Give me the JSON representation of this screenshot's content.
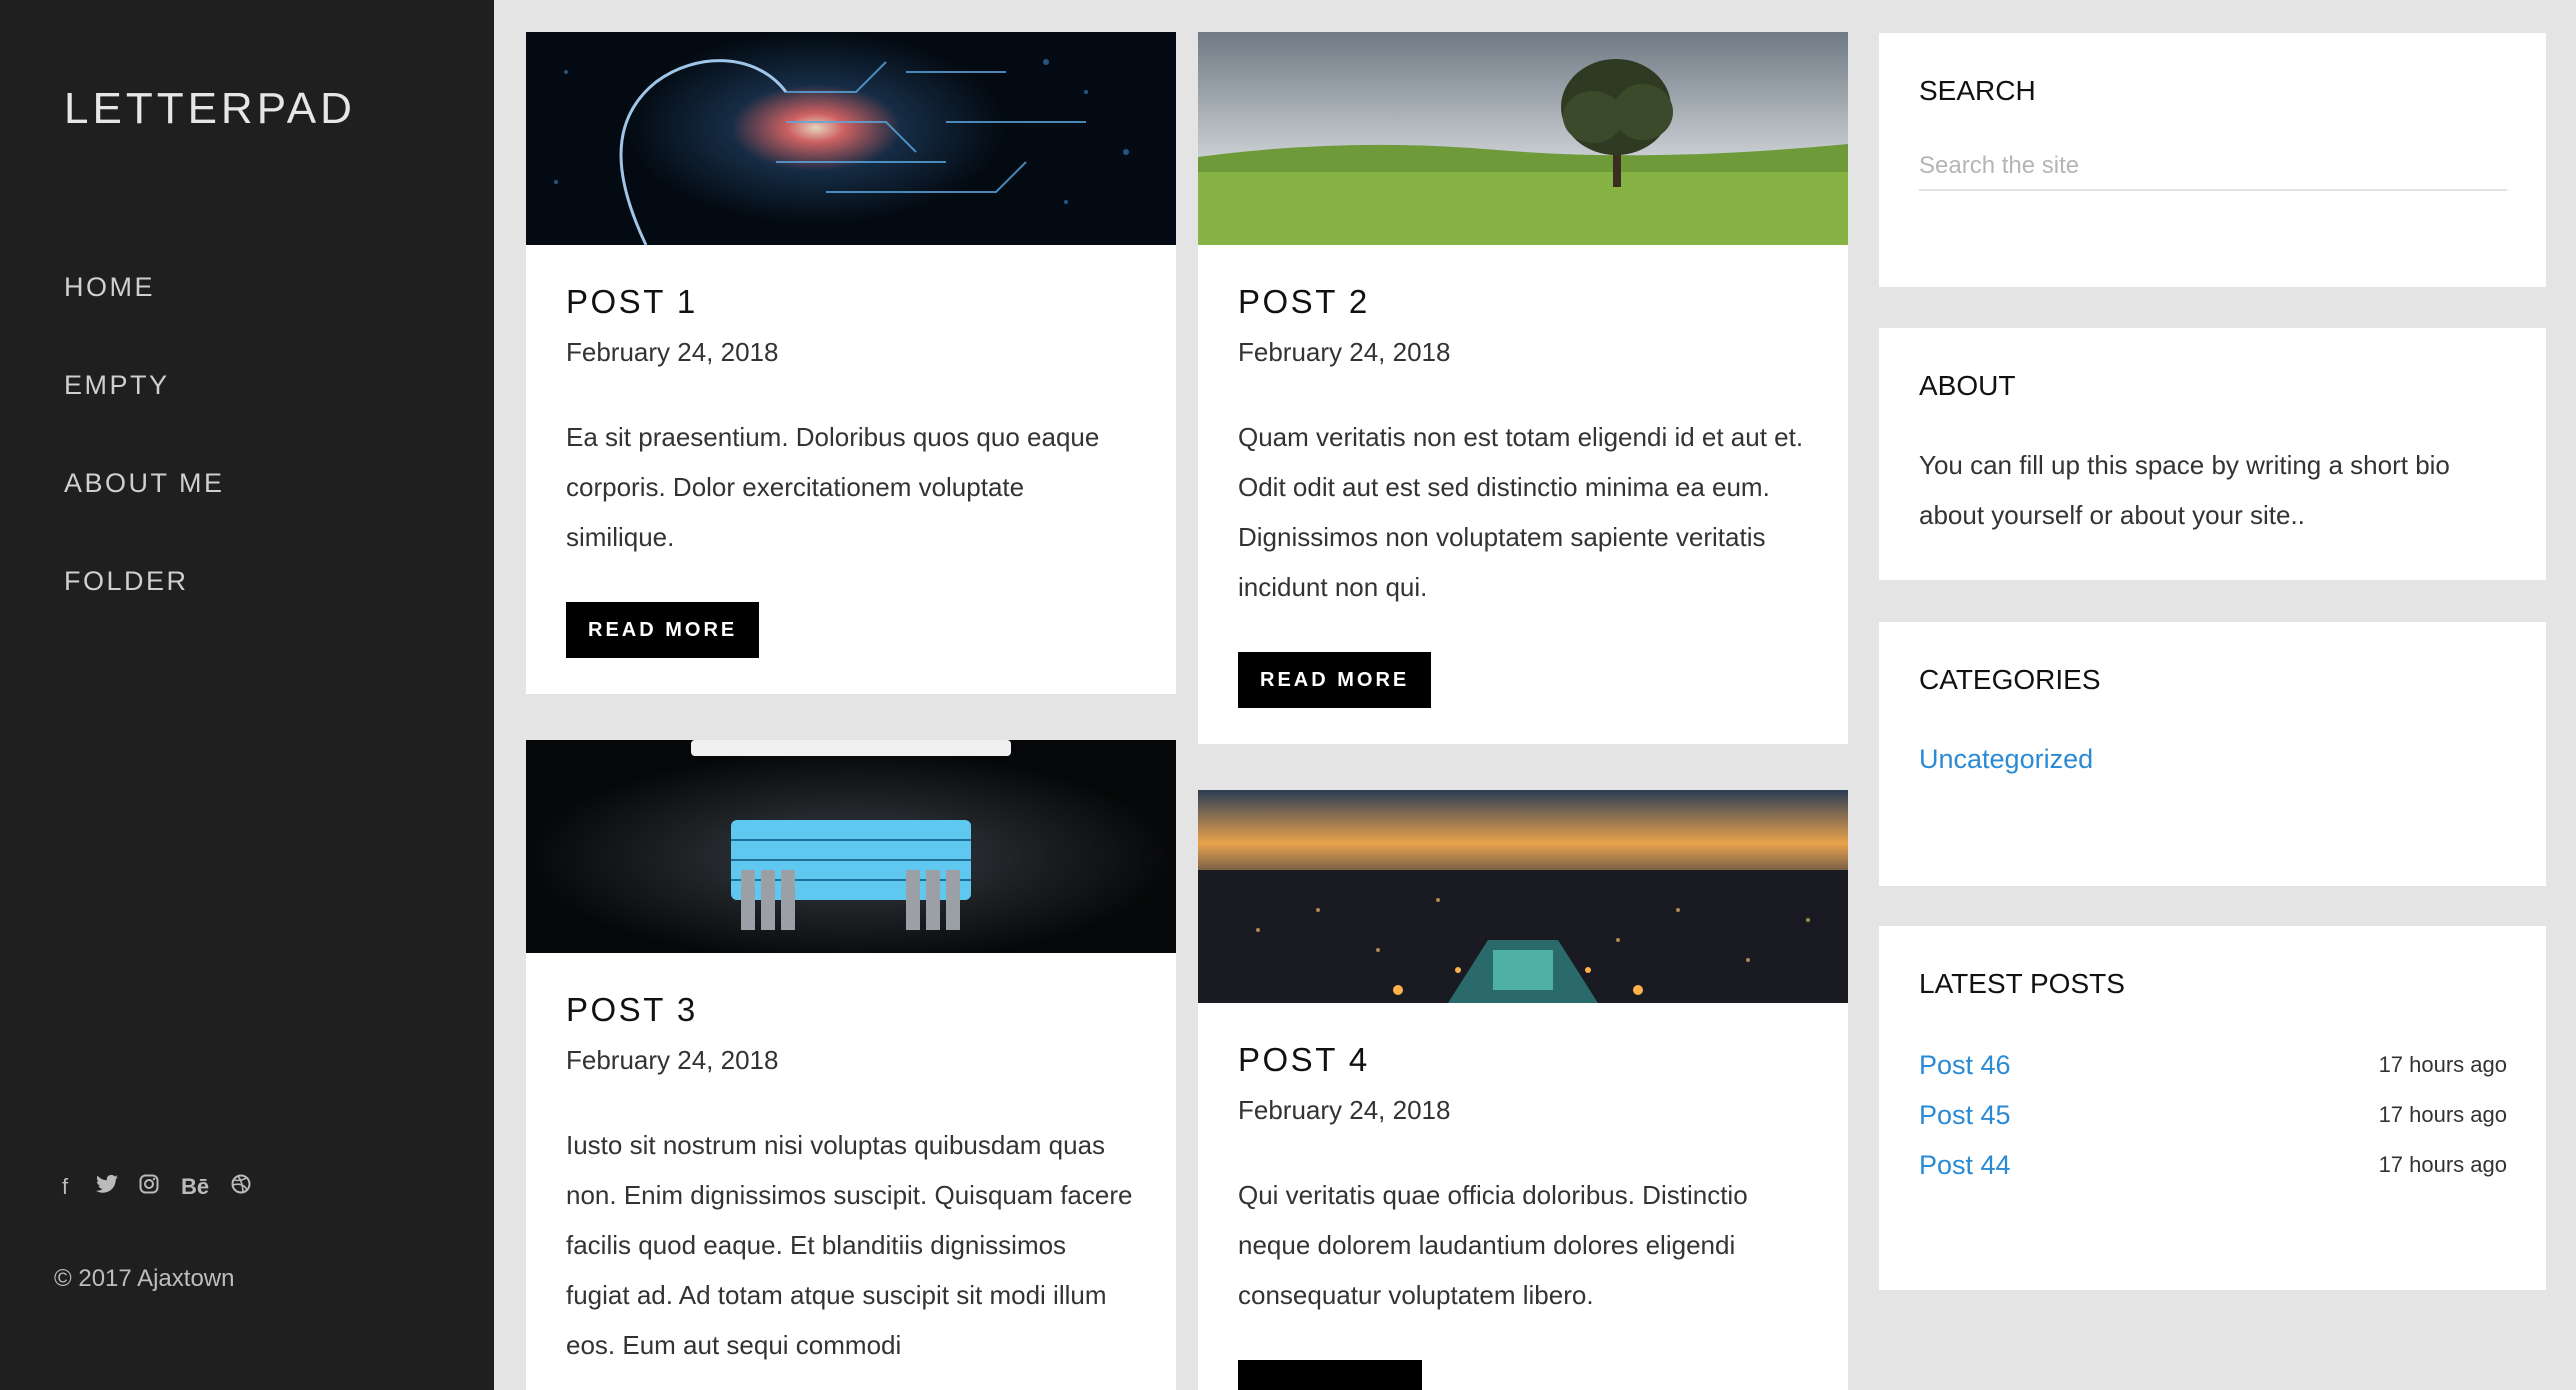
{
  "brand": {
    "name": "LETTERPAD"
  },
  "nav": [
    "HOME",
    "EMPTY",
    "ABOUT ME",
    "FOLDER"
  ],
  "social": [
    {
      "icon": "facebook-icon",
      "glyph": "f"
    },
    {
      "icon": "twitter-icon",
      "glyph": "🐦"
    },
    {
      "icon": "instagram-icon",
      "glyph": "◎"
    },
    {
      "icon": "behance-icon",
      "glyph": "Bē"
    },
    {
      "icon": "dribbble-icon",
      "glyph": "⊛"
    }
  ],
  "copyright": "© 2017 Ajaxtown",
  "posts": [
    {
      "title": "POST 1",
      "date": "February 24, 2018",
      "excerpt": "Ea sit praesentium. Doloribus quos quo eaque corporis. Dolor exercitationem voluptate similique.",
      "button": "READ MORE"
    },
    {
      "title": "POST 2",
      "date": "February 24, 2018",
      "excerpt": "Quam veritatis non est totam eligendi id et aut et. Odit odit aut est sed distinctio minima ea eum. Dignissimos non voluptatem sapiente veritatis incidunt non qui.",
      "button": "READ MORE"
    },
    {
      "title": "POST 3",
      "date": "February 24, 2018",
      "excerpt": "Iusto sit nostrum nisi voluptas quibusdam quas non. Enim dignissimos suscipit. Quisquam facere facilis quod eaque. Et blanditiis dignissimos fugiat ad. Ad totam atque suscipit sit modi illum eos. Eum aut sequi commodi"
    },
    {
      "title": "POST 4",
      "date": "February 24, 2018",
      "excerpt": "Qui veritatis quae officia doloribus. Distinctio neque dolorem laudantium dolores eligendi consequatur voluptatem libero."
    }
  ],
  "widgets": {
    "search": {
      "title": "SEARCH",
      "placeholder": "Search the site"
    },
    "about": {
      "title": "ABOUT",
      "text": "You can fill up this space by writing a short bio about yourself or about your site.."
    },
    "categories": {
      "title": "CATEGORIES",
      "items": [
        "Uncategorized"
      ]
    },
    "latest": {
      "title": "LATEST POSTS",
      "items": [
        {
          "name": "Post 46",
          "time": "17 hours ago"
        },
        {
          "name": "Post 45",
          "time": "17 hours ago"
        },
        {
          "name": "Post 44",
          "time": "17 hours ago"
        }
      ]
    }
  },
  "colors": {
    "sidebar": "#1f1f1f",
    "link": "#2a8ad4",
    "page_bg": "#e4e4e4"
  }
}
